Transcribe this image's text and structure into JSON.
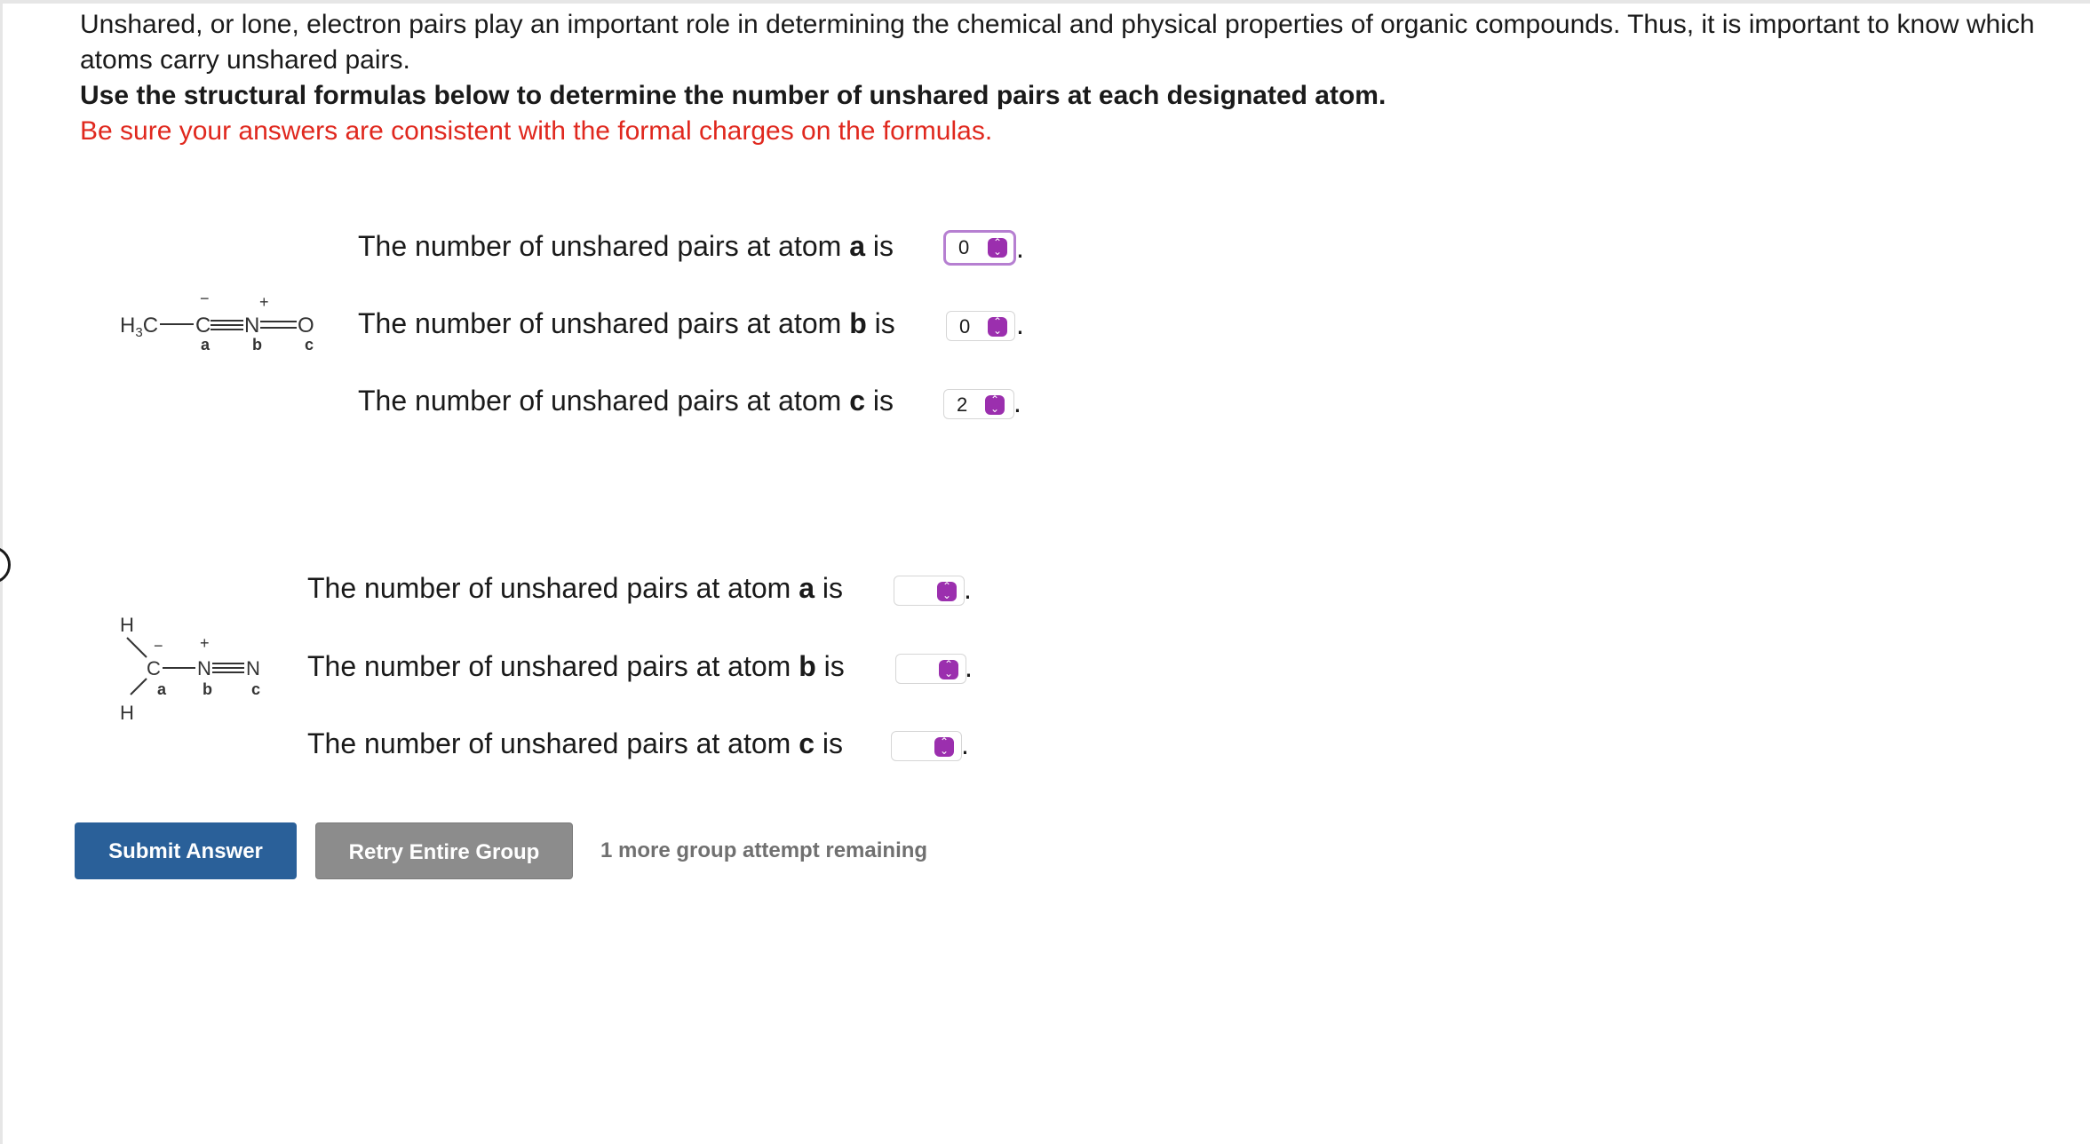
{
  "intro": {
    "line1": "Unshared, or lone, electron pairs play an important role in determining the chemical and physical properties of organic compounds. Thus, it is important to know which atoms carry unshared pairs.",
    "line2": "Use the structural formulas below to determine the number of unshared pairs at each designated atom.",
    "line3": "Be sure your answers are consistent with the formal charges on the formulas."
  },
  "question_prefix": "The number of unshared pairs at atom",
  "question_suffix": "is",
  "period": ".",
  "group1": {
    "formula": {
      "h3c": "H",
      "sub3": "3",
      "c_left": "C",
      "c_mid": "C",
      "n": "N",
      "o": "O",
      "minus": "−",
      "plus": "+",
      "label_a": "a",
      "label_b": "b",
      "label_c": "c"
    },
    "questions": [
      {
        "atom": "a",
        "value": "0"
      },
      {
        "atom": "b",
        "value": "0"
      },
      {
        "atom": "c",
        "value": "2"
      }
    ]
  },
  "group2": {
    "formula": {
      "h_top": "H",
      "h_bottom": "H",
      "c": "C",
      "n1": "N",
      "n2": "N",
      "minus": "−",
      "plus": "+",
      "label_a": "a",
      "label_b": "b",
      "label_c": "c"
    },
    "questions": [
      {
        "atom": "a",
        "value": ""
      },
      {
        "atom": "b",
        "value": ""
      },
      {
        "atom": "c",
        "value": ""
      }
    ]
  },
  "buttons": {
    "submit": "Submit Answer",
    "retry": "Retry Entire Group"
  },
  "attempts_text": "1 more group attempt remaining",
  "icons": {
    "select_arrow": "up-down-chevron-icon"
  },
  "colors": {
    "instruction_red": "#e0281e",
    "submit_blue": "#2a6099",
    "retry_gray": "#8c8c8c",
    "select_purple": "#9b2fae",
    "focus_border": "#b67fd1"
  }
}
